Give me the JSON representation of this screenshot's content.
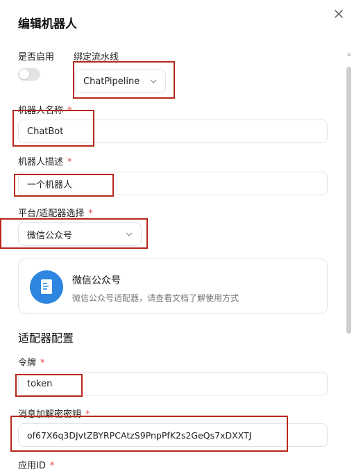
{
  "dialog": {
    "title": "编辑机器人"
  },
  "fields": {
    "enable": {
      "label": "是否启用",
      "value": false
    },
    "pipeline": {
      "label": "绑定流水线",
      "value": "ChatPipeline"
    },
    "bot_name": {
      "label": "机器人名称",
      "required": "*",
      "value": "ChatBot"
    },
    "bot_desc": {
      "label": "机器人描述",
      "required": "*",
      "value": "一个机器人"
    },
    "platform": {
      "label": "平台/适配器选择",
      "required": "*",
      "value": "微信公众号"
    }
  },
  "adapter_card": {
    "title": "微信公众号",
    "description": "微信公众号适配器，请查看文档了解使用方式",
    "icon": "document-icon",
    "icon_color": "#2f86e0"
  },
  "adapter_config": {
    "section_title": "适配器配置",
    "token": {
      "label": "令牌",
      "required": "*",
      "value": "token"
    },
    "encoding_key": {
      "label": "消息加解密密钥",
      "required": "*",
      "value": "of67X6q3DJvtZBYRPCAtzS9PnpPfK2s2GeQs7xDXXTJ"
    },
    "app_id": {
      "label": "应用ID",
      "required": "*"
    }
  },
  "colors": {
    "highlight": "#b7281b",
    "required": "#e5484d",
    "border": "#e3e3e6"
  }
}
